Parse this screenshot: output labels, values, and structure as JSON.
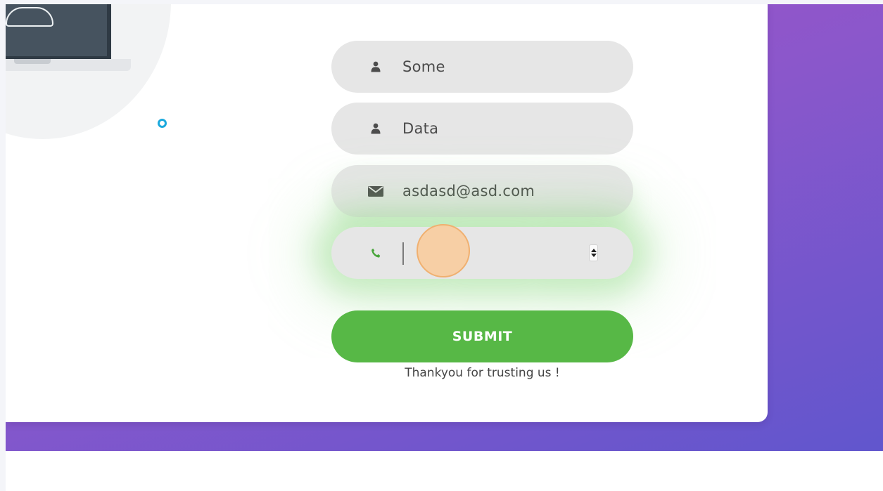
{
  "form": {
    "first_name_value": "Some",
    "last_name_value": "Data",
    "email_value": "asdasd@asd.com",
    "phone_value": "",
    "submit_label": "SUBMIT",
    "footer_text": "Thankyou for trusting us !"
  },
  "icons": {
    "first_name": "user-icon",
    "last_name": "user-icon",
    "email": "envelope-icon",
    "phone": "phone-icon"
  },
  "colors": {
    "accent_green": "#57b846",
    "gradient_start": "#a651c6",
    "gradient_end": "#6156cd",
    "field_background": "#e6e6e6"
  }
}
